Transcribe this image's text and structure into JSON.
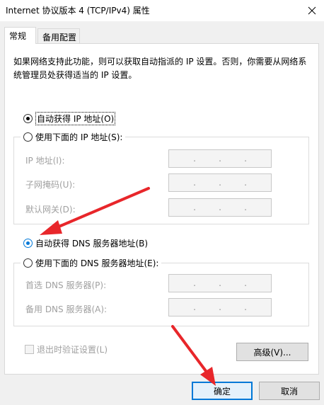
{
  "window": {
    "title": "Internet 协议版本 4 (TCP/IPv4) 属性",
    "close_icon": "close-icon"
  },
  "tabs": [
    {
      "label": "常规",
      "selected": true
    },
    {
      "label": "备用配置",
      "selected": false
    }
  ],
  "description": "如果网络支持此功能，则可以获取自动指派的 IP 设置。否则，你需要从网络系统管理员处获得适当的 IP 设置。",
  "ip_section": {
    "auto_option": "自动获得 IP 地址(O)",
    "auto_selected": true,
    "manual_option": "使用下面的 IP 地址(S):",
    "fields": [
      {
        "label": "IP 地址(I):",
        "value": ". . ."
      },
      {
        "label": "子网掩码(U):",
        "value": ". . ."
      },
      {
        "label": "默认网关(D):",
        "value": ". . ."
      }
    ]
  },
  "dns_section": {
    "auto_option": "自动获得 DNS 服务器地址(B)",
    "auto_selected": true,
    "manual_option": "使用下面的 DNS 服务器地址(E):",
    "fields": [
      {
        "label": "首选 DNS 服务器(P):",
        "value": ". . ."
      },
      {
        "label": "备用 DNS 服务器(A):",
        "value": ". . ."
      }
    ]
  },
  "validate_on_exit": {
    "label": "退出时验证设置(L)",
    "checked": false,
    "enabled": false
  },
  "buttons": {
    "advanced": "高级(V)...",
    "ok": "确定",
    "cancel": "取消"
  },
  "colors": {
    "annotation_arrow": "#e8262a",
    "focus_accent": "#0078d7"
  }
}
